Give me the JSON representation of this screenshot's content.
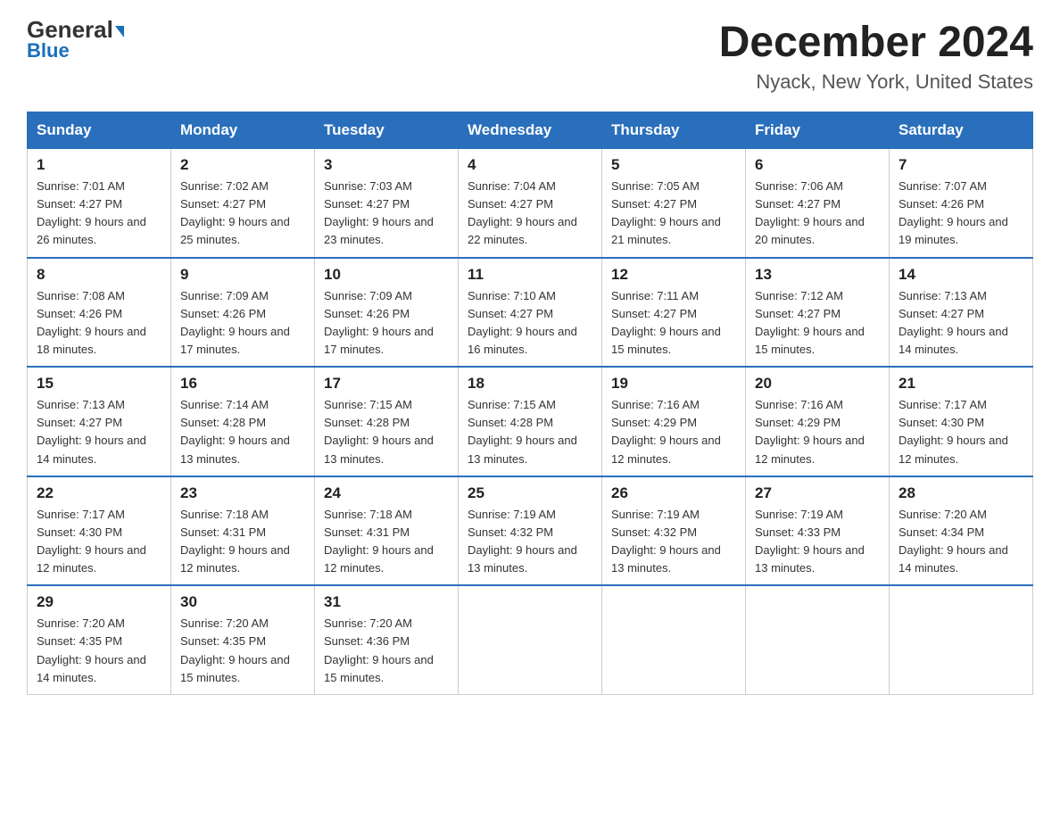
{
  "header": {
    "logo_main": "General",
    "logo_sub": "Blue",
    "month": "December 2024",
    "location": "Nyack, New York, United States"
  },
  "days_of_week": [
    "Sunday",
    "Monday",
    "Tuesday",
    "Wednesday",
    "Thursday",
    "Friday",
    "Saturday"
  ],
  "weeks": [
    [
      {
        "day": "1",
        "sunrise": "7:01 AM",
        "sunset": "4:27 PM",
        "daylight": "9 hours and 26 minutes."
      },
      {
        "day": "2",
        "sunrise": "7:02 AM",
        "sunset": "4:27 PM",
        "daylight": "9 hours and 25 minutes."
      },
      {
        "day": "3",
        "sunrise": "7:03 AM",
        "sunset": "4:27 PM",
        "daylight": "9 hours and 23 minutes."
      },
      {
        "day": "4",
        "sunrise": "7:04 AM",
        "sunset": "4:27 PM",
        "daylight": "9 hours and 22 minutes."
      },
      {
        "day": "5",
        "sunrise": "7:05 AM",
        "sunset": "4:27 PM",
        "daylight": "9 hours and 21 minutes."
      },
      {
        "day": "6",
        "sunrise": "7:06 AM",
        "sunset": "4:27 PM",
        "daylight": "9 hours and 20 minutes."
      },
      {
        "day": "7",
        "sunrise": "7:07 AM",
        "sunset": "4:26 PM",
        "daylight": "9 hours and 19 minutes."
      }
    ],
    [
      {
        "day": "8",
        "sunrise": "7:08 AM",
        "sunset": "4:26 PM",
        "daylight": "9 hours and 18 minutes."
      },
      {
        "day": "9",
        "sunrise": "7:09 AM",
        "sunset": "4:26 PM",
        "daylight": "9 hours and 17 minutes."
      },
      {
        "day": "10",
        "sunrise": "7:09 AM",
        "sunset": "4:26 PM",
        "daylight": "9 hours and 17 minutes."
      },
      {
        "day": "11",
        "sunrise": "7:10 AM",
        "sunset": "4:27 PM",
        "daylight": "9 hours and 16 minutes."
      },
      {
        "day": "12",
        "sunrise": "7:11 AM",
        "sunset": "4:27 PM",
        "daylight": "9 hours and 15 minutes."
      },
      {
        "day": "13",
        "sunrise": "7:12 AM",
        "sunset": "4:27 PM",
        "daylight": "9 hours and 15 minutes."
      },
      {
        "day": "14",
        "sunrise": "7:13 AM",
        "sunset": "4:27 PM",
        "daylight": "9 hours and 14 minutes."
      }
    ],
    [
      {
        "day": "15",
        "sunrise": "7:13 AM",
        "sunset": "4:27 PM",
        "daylight": "9 hours and 14 minutes."
      },
      {
        "day": "16",
        "sunrise": "7:14 AM",
        "sunset": "4:28 PM",
        "daylight": "9 hours and 13 minutes."
      },
      {
        "day": "17",
        "sunrise": "7:15 AM",
        "sunset": "4:28 PM",
        "daylight": "9 hours and 13 minutes."
      },
      {
        "day": "18",
        "sunrise": "7:15 AM",
        "sunset": "4:28 PM",
        "daylight": "9 hours and 13 minutes."
      },
      {
        "day": "19",
        "sunrise": "7:16 AM",
        "sunset": "4:29 PM",
        "daylight": "9 hours and 12 minutes."
      },
      {
        "day": "20",
        "sunrise": "7:16 AM",
        "sunset": "4:29 PM",
        "daylight": "9 hours and 12 minutes."
      },
      {
        "day": "21",
        "sunrise": "7:17 AM",
        "sunset": "4:30 PM",
        "daylight": "9 hours and 12 minutes."
      }
    ],
    [
      {
        "day": "22",
        "sunrise": "7:17 AM",
        "sunset": "4:30 PM",
        "daylight": "9 hours and 12 minutes."
      },
      {
        "day": "23",
        "sunrise": "7:18 AM",
        "sunset": "4:31 PM",
        "daylight": "9 hours and 12 minutes."
      },
      {
        "day": "24",
        "sunrise": "7:18 AM",
        "sunset": "4:31 PM",
        "daylight": "9 hours and 12 minutes."
      },
      {
        "day": "25",
        "sunrise": "7:19 AM",
        "sunset": "4:32 PM",
        "daylight": "9 hours and 13 minutes."
      },
      {
        "day": "26",
        "sunrise": "7:19 AM",
        "sunset": "4:32 PM",
        "daylight": "9 hours and 13 minutes."
      },
      {
        "day": "27",
        "sunrise": "7:19 AM",
        "sunset": "4:33 PM",
        "daylight": "9 hours and 13 minutes."
      },
      {
        "day": "28",
        "sunrise": "7:20 AM",
        "sunset": "4:34 PM",
        "daylight": "9 hours and 14 minutes."
      }
    ],
    [
      {
        "day": "29",
        "sunrise": "7:20 AM",
        "sunset": "4:35 PM",
        "daylight": "9 hours and 14 minutes."
      },
      {
        "day": "30",
        "sunrise": "7:20 AM",
        "sunset": "4:35 PM",
        "daylight": "9 hours and 15 minutes."
      },
      {
        "day": "31",
        "sunrise": "7:20 AM",
        "sunset": "4:36 PM",
        "daylight": "9 hours and 15 minutes."
      },
      null,
      null,
      null,
      null
    ]
  ],
  "labels": {
    "sunrise": "Sunrise:",
    "sunset": "Sunset:",
    "daylight": "Daylight:"
  }
}
